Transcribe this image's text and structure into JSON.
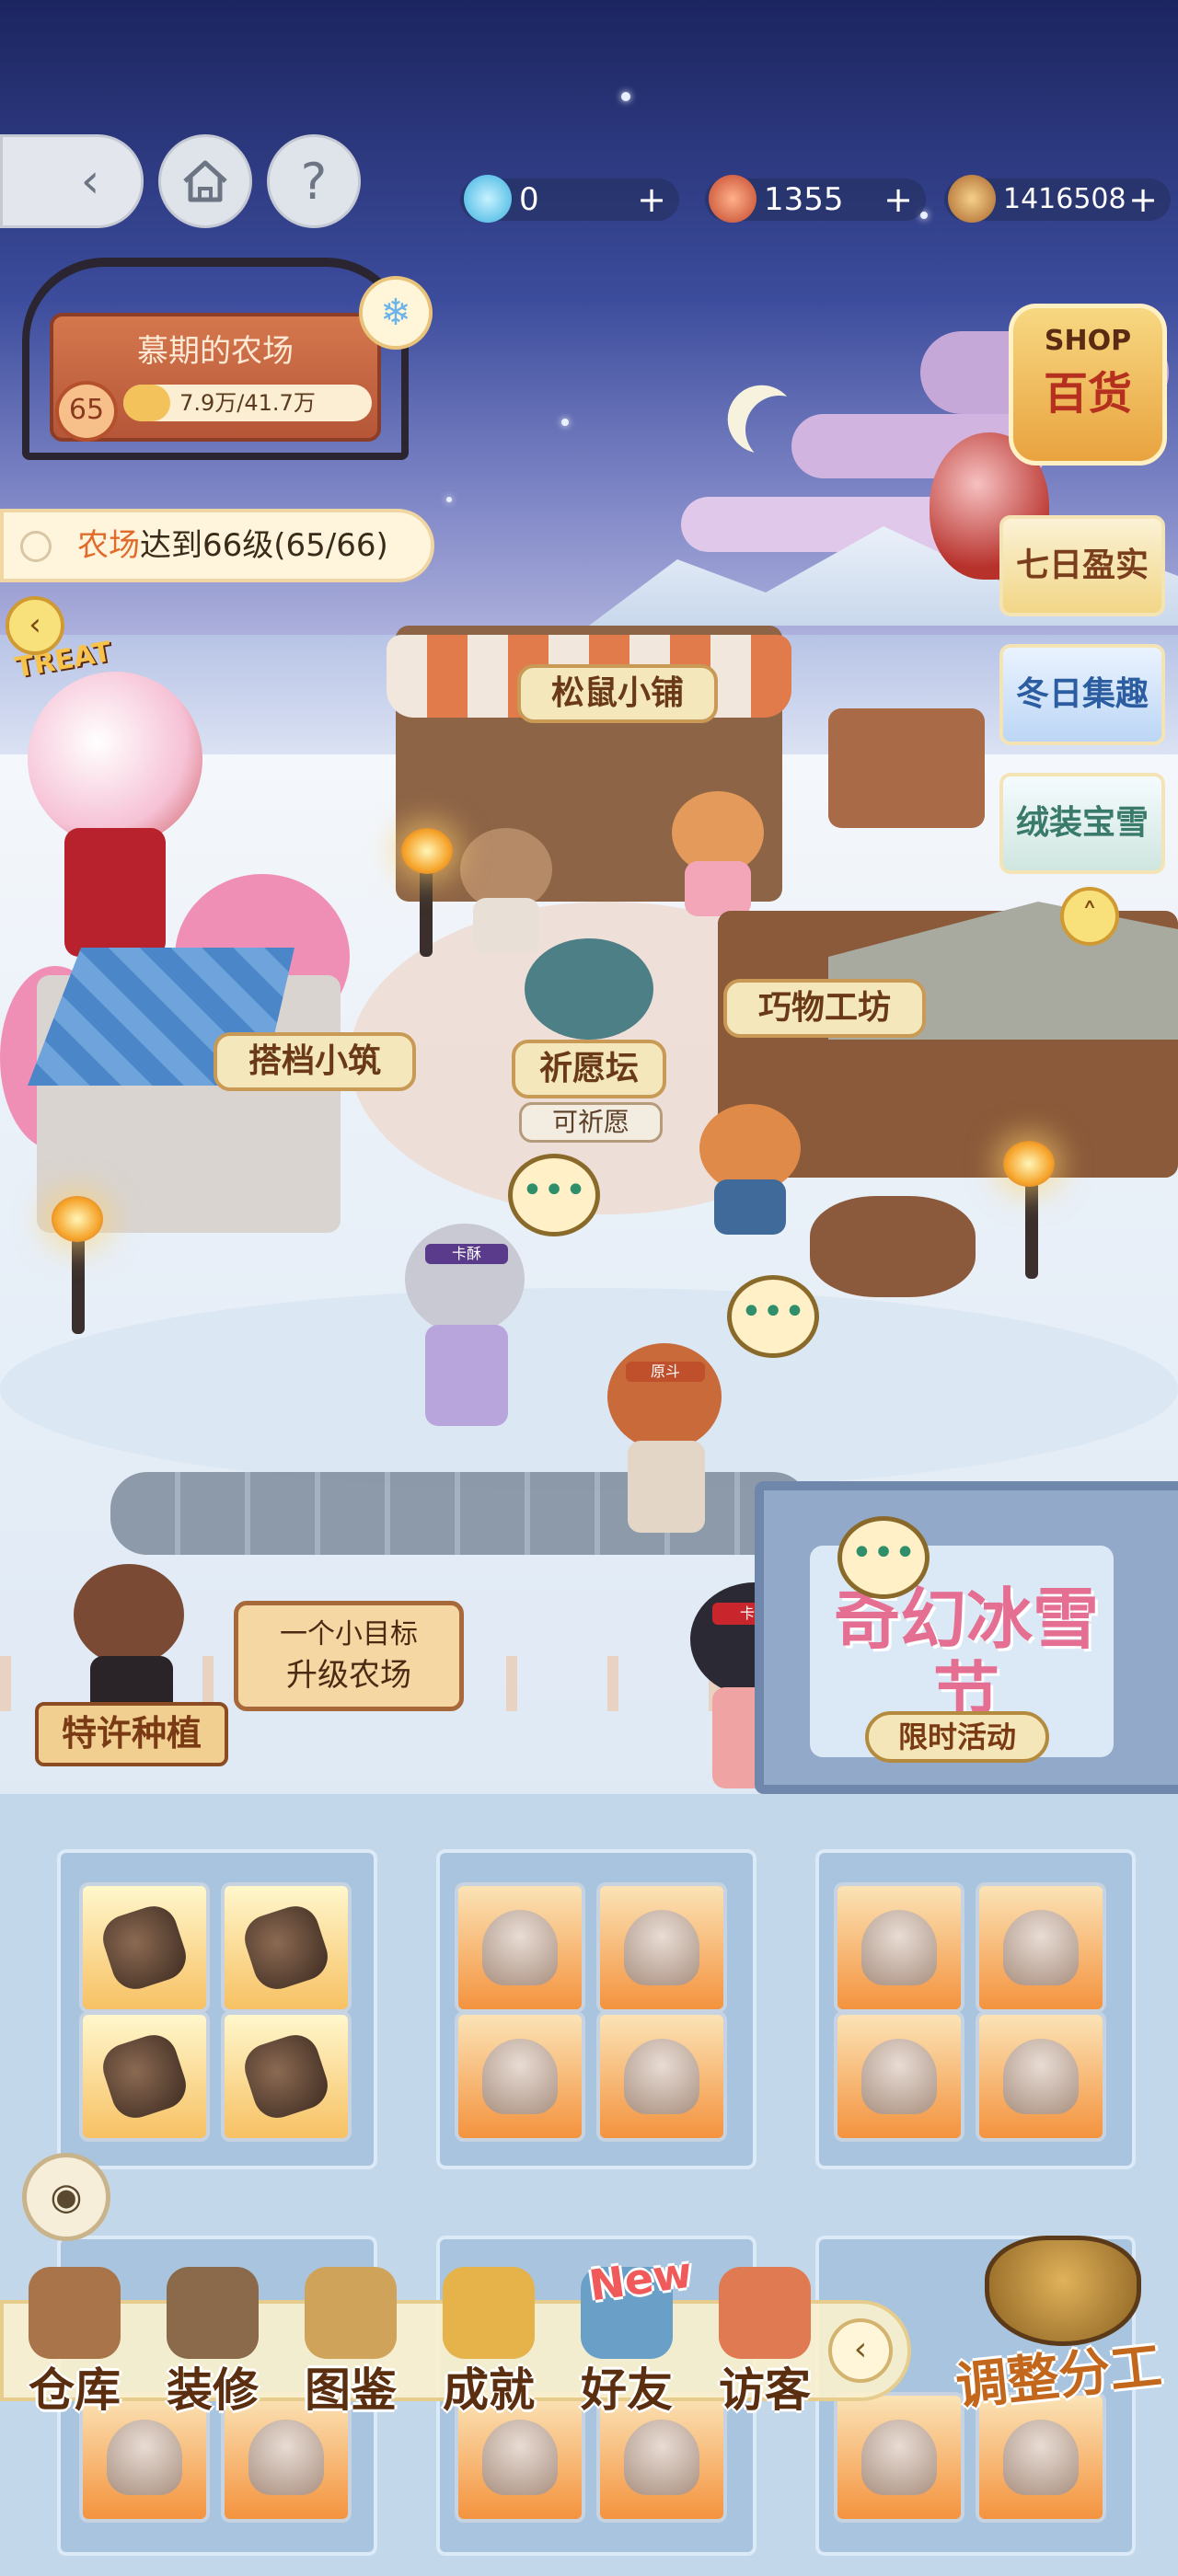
{
  "colors": {
    "accent": "#e06b2b",
    "sky": "#1c2560",
    "hud_bg": "#dfe3ea"
  },
  "top_bar": {
    "back_icon": "back-arrow-icon",
    "home_icon": "home-icon",
    "help_label": "?",
    "currencies": [
      {
        "icon": "diamond-icon",
        "value": "0",
        "plus": "+"
      },
      {
        "icon": "feather-icon",
        "value": "1355",
        "plus": "+"
      },
      {
        "icon": "coin-icon",
        "value": "1416508",
        "plus": "+"
      }
    ]
  },
  "farm": {
    "name": "慕期的农场",
    "level": "65",
    "exp_text": "7.9万/41.7万",
    "exp_progress": 0.19
  },
  "quest": {
    "prefix": "农场",
    "suffix": "达到66级(65/66)"
  },
  "side_menu": {
    "shop_top": "SHOP",
    "shop_bottom": "百货",
    "tabs": [
      "七日盈实",
      "冬日集趣",
      "绒装宝雪"
    ]
  },
  "places": {
    "squirrel_shop": "松鼠小铺",
    "partner_house": "搭档小筑",
    "wish_altar": "祈愿坛",
    "wish_status": "可祈愿",
    "craft_workshop": "巧物工坊",
    "treat_sign": "TREAT"
  },
  "characters": {
    "headband_text": "卡酥",
    "headband_text_2": "原斗"
  },
  "goal_sign": {
    "line1": "一个小目标",
    "line2": "升级农场"
  },
  "plant_sign": "特许种植",
  "event": {
    "title": "奇幻冰雪节",
    "tag": "限时活动"
  },
  "bottom_nav": [
    {
      "label": "仓库",
      "icon": "warehouse-icon"
    },
    {
      "label": "装修",
      "icon": "hammer-icon"
    },
    {
      "label": "图鉴",
      "icon": "book-icon"
    },
    {
      "label": "成就",
      "icon": "trophy-icon"
    },
    {
      "label": "好友",
      "icon": "friends-icon"
    },
    {
      "label": "访客",
      "icon": "visitor-icon"
    }
  ],
  "new_badge": "New",
  "assign_button": "调整分工"
}
